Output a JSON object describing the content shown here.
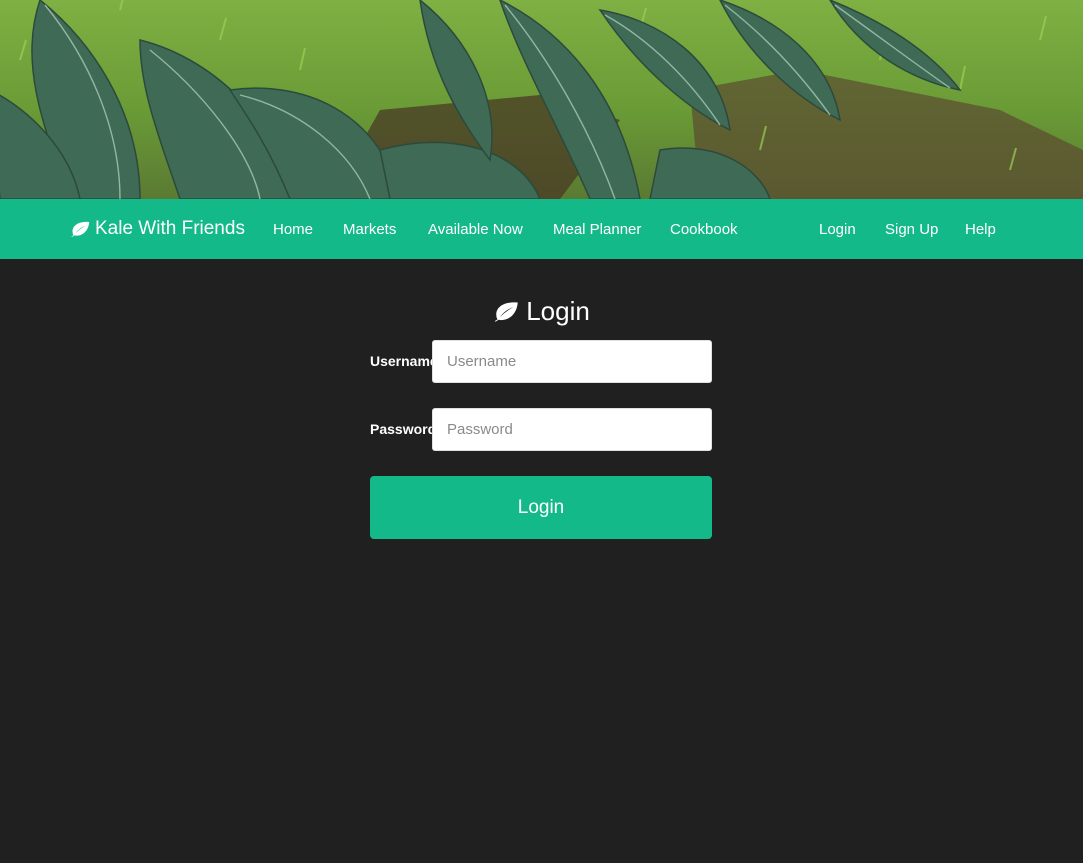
{
  "brand": {
    "name": "Kale With Friends",
    "icon": "leaf-icon"
  },
  "nav": {
    "left": [
      {
        "label": "Home"
      },
      {
        "label": "Markets"
      },
      {
        "label": "Available Now"
      },
      {
        "label": "Meal Planner"
      },
      {
        "label": "Cookbook"
      }
    ],
    "right": [
      {
        "label": "Login"
      },
      {
        "label": "Sign Up"
      },
      {
        "label": "Help"
      }
    ]
  },
  "login": {
    "title": "Login",
    "title_icon": "leaf-icon",
    "username_label": "Username",
    "username_placeholder": "Username",
    "username_value": "",
    "password_label": "Password",
    "password_placeholder": "Password",
    "password_value": "",
    "submit_label": "Login"
  },
  "colors": {
    "accent": "#14b98a",
    "background": "#202020",
    "text": "#ffffff"
  }
}
